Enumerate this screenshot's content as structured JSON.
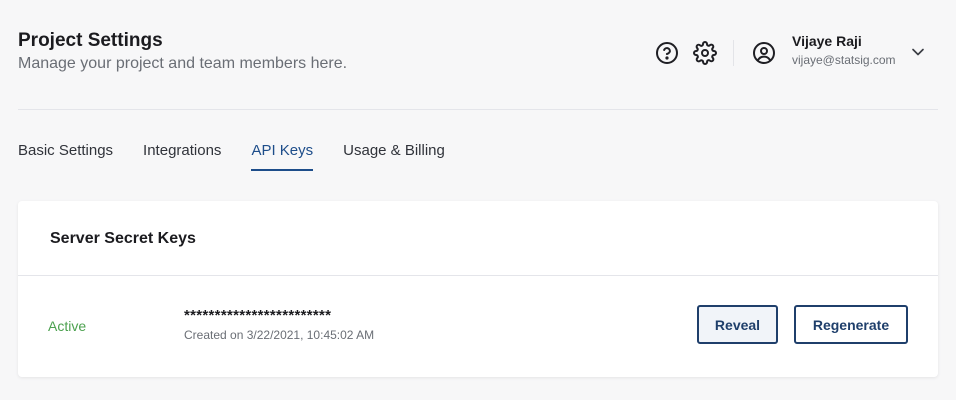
{
  "header": {
    "title": "Project Settings",
    "subtitle": "Manage your project and team members here.",
    "icons": [
      "help-circle-icon",
      "gear-icon",
      "user-circle-icon",
      "chevron-down-icon"
    ]
  },
  "user": {
    "name": "Vijaye Raji",
    "email": "vijaye@statsig.com"
  },
  "tabs": [
    {
      "label": "Basic Settings",
      "active": false
    },
    {
      "label": "Integrations",
      "active": false
    },
    {
      "label": "API Keys",
      "active": true
    },
    {
      "label": "Usage & Billing",
      "active": false
    }
  ],
  "card": {
    "title": "Server Secret Keys",
    "key": {
      "status": "Active",
      "masked_value": "************************",
      "created": "Created on 3/22/2021, 10:45:02 AM",
      "reveal_label": "Reveal",
      "regenerate_label": "Regenerate"
    }
  },
  "colors": {
    "accent": "#1d4d8a",
    "button_border": "#1f3f6b",
    "status_active": "#4ca14f",
    "background": "#f7f7f8"
  }
}
